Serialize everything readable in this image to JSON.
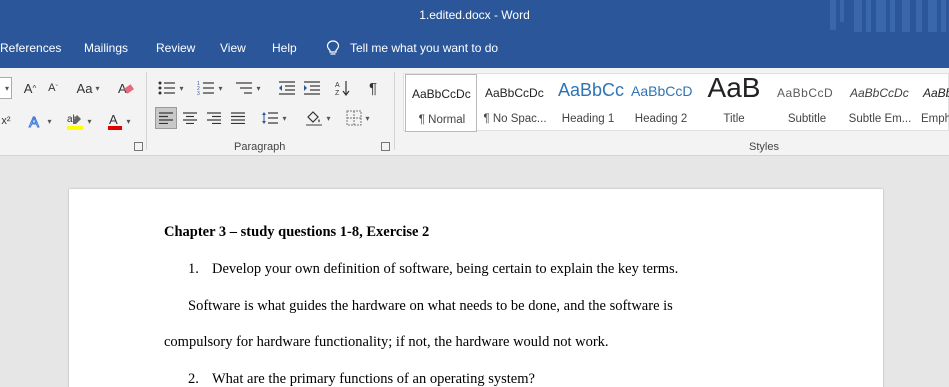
{
  "window": {
    "title": "1.edited.docx  -  Word"
  },
  "tabs": [
    "References",
    "Mailings",
    "Review",
    "View",
    "Help"
  ],
  "tell_me": "Tell me what you want to do",
  "ribbon": {
    "font_group": {
      "grow_label": "A",
      "shrink_label": "A",
      "case_label": "Aa"
    },
    "groups": {
      "paragraph": "Paragraph",
      "styles": "Styles"
    }
  },
  "styles": [
    {
      "preview": "AaBbCcDc",
      "label": "¶ Normal"
    },
    {
      "preview": "AaBbCcDc",
      "label": "¶ No Spac..."
    },
    {
      "preview": "AaBbCc",
      "label": "Heading 1"
    },
    {
      "preview": "AaBbCcD",
      "label": "Heading 2"
    },
    {
      "preview": "AaB",
      "label": "Title"
    },
    {
      "preview": "AaBbCcD",
      "label": "Subtitle"
    },
    {
      "preview": "AaBbCcDc",
      "label": "Subtle Em..."
    },
    {
      "preview": "AaBb",
      "label": "Emph"
    }
  ],
  "document": {
    "heading": "Chapter 3 – study questions 1-8, Exercise 2",
    "q1_num": "1.",
    "q1_text": "Develop your own definition of software, being certain to explain the key terms.",
    "p1_line1": "Software is what guides the hardware on what needs to be done, and the software is",
    "p1_line2": "compulsory for hardware functionality; if not, the hardware would not work.",
    "q2_num": "2.",
    "q2_text": "What are the primary functions of an operating system?"
  },
  "colors": {
    "title_bar": "#2b579a",
    "ribbon_bg": "#f3f3f3",
    "canvas_bg": "#e6e6e6",
    "highlight_yellow": "#ffff00",
    "font_color_red": "#e00000"
  }
}
